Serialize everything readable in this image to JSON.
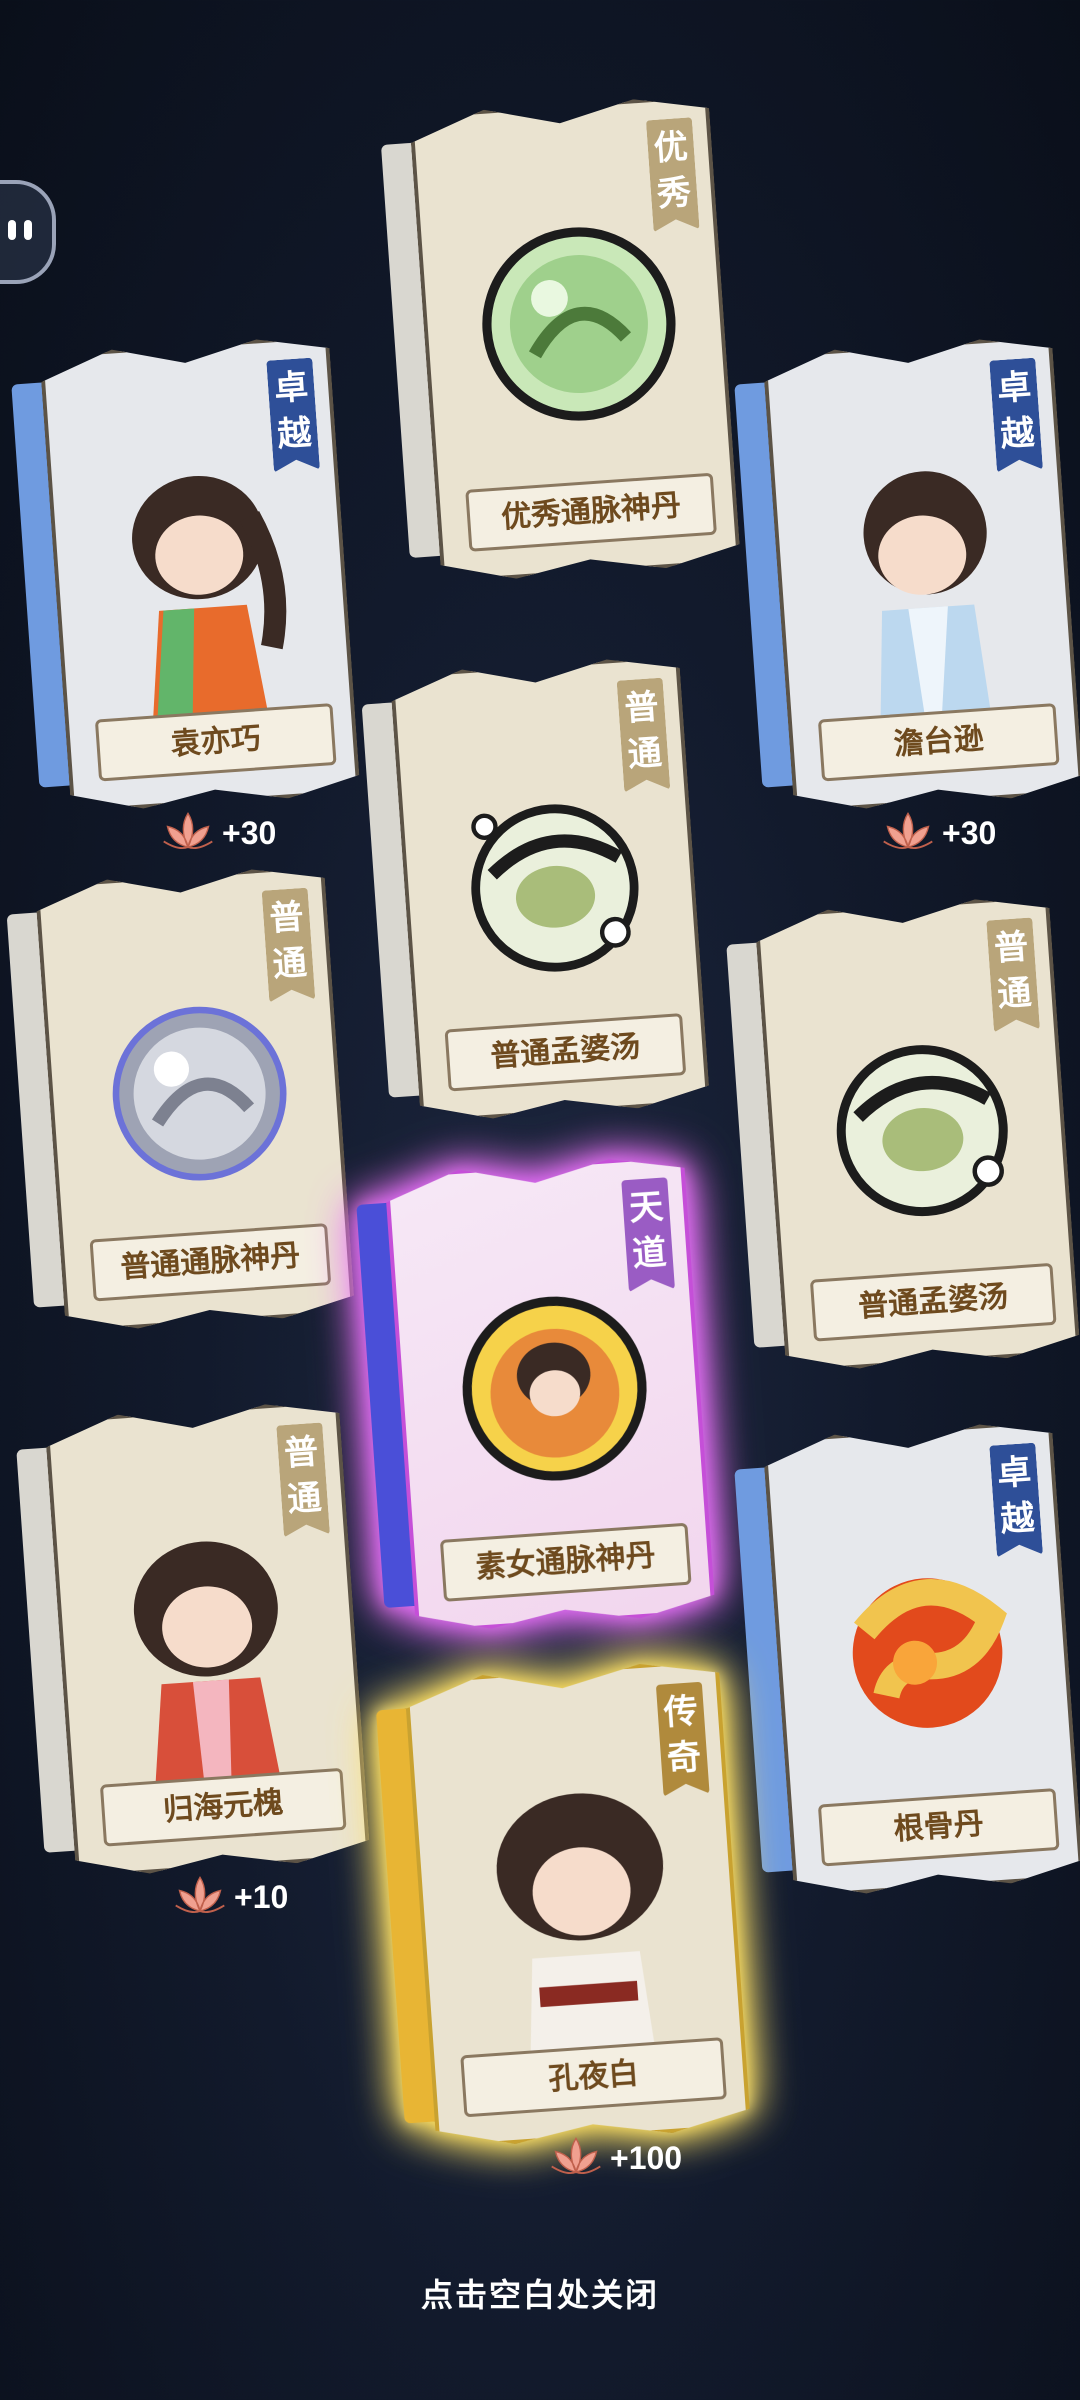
{
  "cards": [
    {
      "id": "card-youxiu-tongmai",
      "name": "优秀通脉神丹",
      "rarity": "优秀",
      "rarity_color": "#b9a57a",
      "spine_color": "#d9d7d0"
    },
    {
      "id": "card-yuan-yiqiao",
      "name": "袁亦巧",
      "rarity": "卓越",
      "rarity_color": "#2e4f98",
      "spine_color": "#6f9be0"
    },
    {
      "id": "card-tantai-xun",
      "name": "澹台逊",
      "rarity": "卓越",
      "rarity_color": "#2e4f98",
      "spine_color": "#6f9be0"
    },
    {
      "id": "card-putong-mengpo-1",
      "name": "普通孟婆汤",
      "rarity": "普通",
      "rarity_color": "#b9a57a",
      "spine_color": "#d9d7d0"
    },
    {
      "id": "card-putong-tongmai",
      "name": "普通通脉神丹",
      "rarity": "普通",
      "rarity_color": "#b9a57a",
      "spine_color": "#d9d7d0"
    },
    {
      "id": "card-putong-mengpo-2",
      "name": "普通孟婆汤",
      "rarity": "普通",
      "rarity_color": "#b9a57a",
      "spine_color": "#d9d7d0"
    },
    {
      "id": "card-sunv-tongmai",
      "name": "素女通脉神丹",
      "rarity": "天道",
      "rarity_color": "#9a5cc4",
      "spine_color": "#4a4fd8"
    },
    {
      "id": "card-guihai-yuanhuai",
      "name": "归海元槐",
      "rarity": "普通",
      "rarity_color": "#b9a57a",
      "spine_color": "#d9d7d0"
    },
    {
      "id": "card-gengu-dan",
      "name": "根骨丹",
      "rarity": "卓越",
      "rarity_color": "#2e4f98",
      "spine_color": "#6f9be0"
    },
    {
      "id": "card-kong-yebai",
      "name": "孔夜白",
      "rarity": "传奇",
      "rarity_color": "#b08a3c",
      "spine_color": "#e8b534"
    }
  ],
  "rewards": [
    {
      "id": "reward-yuan-yiqiao",
      "text": "+30"
    },
    {
      "id": "reward-tantai-xun",
      "text": "+30"
    },
    {
      "id": "reward-guihai-yuanhuai",
      "text": "+10"
    },
    {
      "id": "reward-kong-yebai",
      "text": "+100"
    }
  ],
  "close_hint": "点击空白处关闭"
}
